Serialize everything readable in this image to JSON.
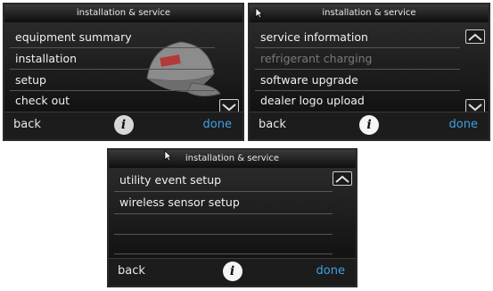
{
  "screens": [
    {
      "title": "installation & service",
      "items": [
        {
          "label": "equipment summary",
          "disabled": false
        },
        {
          "label": "installation",
          "disabled": false
        },
        {
          "label": "setup",
          "disabled": false
        },
        {
          "label": "check out",
          "disabled": false
        }
      ],
      "footer": {
        "back": "back",
        "info": "i",
        "done": "done"
      }
    },
    {
      "title": "installation & service",
      "items": [
        {
          "label": "service information",
          "disabled": false
        },
        {
          "label": "refrigerant charging",
          "disabled": true
        },
        {
          "label": "software upgrade",
          "disabled": false
        },
        {
          "label": "dealer logo upload",
          "disabled": false
        }
      ],
      "footer": {
        "back": "back",
        "info": "i",
        "done": "done"
      }
    },
    {
      "title": "installation & service",
      "items": [
        {
          "label": "utility event setup",
          "disabled": false
        },
        {
          "label": "wireless sensor setup",
          "disabled": false
        }
      ],
      "footer": {
        "back": "back",
        "info": "i",
        "done": "done"
      }
    }
  ],
  "colors": {
    "done": "#3fa1e0",
    "disabled": "#7a7a7a",
    "text": "#f0f0f0"
  },
  "icons": [
    "scroll-up-icon",
    "scroll-down-icon",
    "info-icon",
    "cap-illustration",
    "pointer-cursor-icon"
  ]
}
